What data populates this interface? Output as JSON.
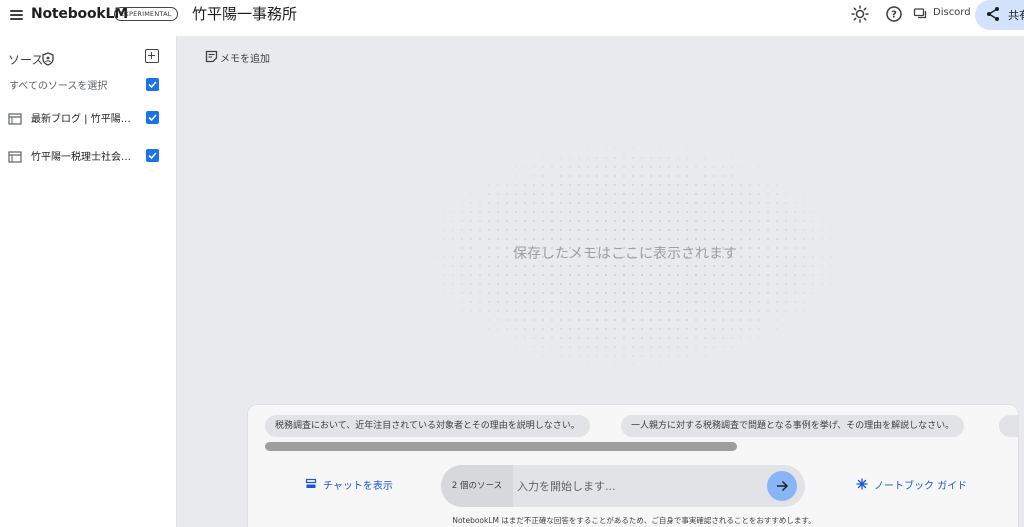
{
  "header": {
    "app_name": "NotebookLM",
    "badge": "EXPERIMENTAL",
    "notebook_title": "竹平陽一事務所",
    "discord_label": "Discord",
    "share_label": "共有"
  },
  "sidebar": {
    "sources_label": "ソース",
    "select_all_label": "すべてのソースを選択",
    "items": [
      {
        "title": "最新ブログ | 竹平陽一税理士事務所",
        "checked": true
      },
      {
        "title": "竹平陽一税理士社会保険労務士事務所",
        "checked": true
      }
    ]
  },
  "main": {
    "add_memo_label": "メモを追加",
    "empty_message": "保存したメモはここに表示されます"
  },
  "chat": {
    "suggestions": [
      "税務調査において、近年注目されている対象者とその理由を説明しなさい。",
      "一人親方に対する税務調査で問題となる事例を挙げ、その理由を解説しなさい。"
    ],
    "show_chat_label": "チャットを表示",
    "source_count": "2 個のソース",
    "input_placeholder": "入力を開始します...",
    "guide_label": "ノートブック ガイド",
    "disclaimer": "NotebookLM はまだ不正確な回答をすることがあるため、ご自身で事実確認されることをおすすめします。"
  },
  "colors": {
    "accent": "#1a73e8",
    "share_bg": "#d3e3fd",
    "main_bg": "#e9eaee",
    "send_btn": "#8ab4f8"
  },
  "icons": [
    "menu-icon",
    "sun-icon",
    "help-icon",
    "discord-icon",
    "share-icon",
    "shield-icon",
    "add-source-icon",
    "checkbox-icon",
    "document-icon",
    "note-add-icon",
    "chat-icon",
    "arrow-right-icon",
    "sparkle-icon"
  ]
}
